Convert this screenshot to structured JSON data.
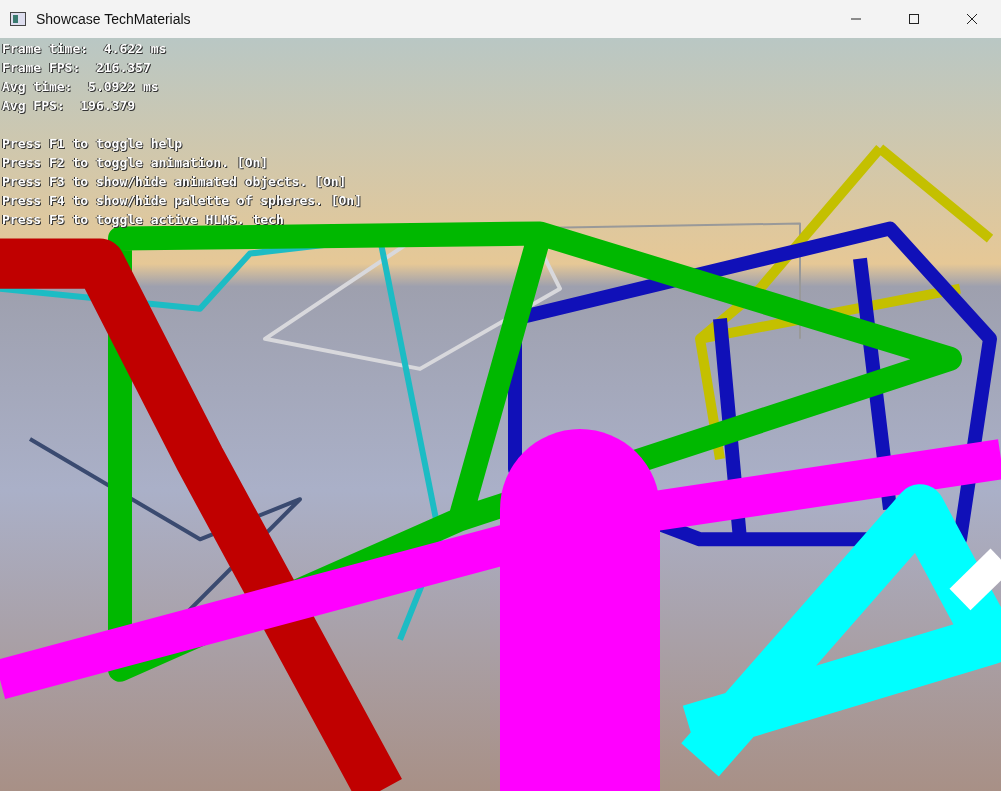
{
  "window": {
    "title": "Showcase TechMaterials"
  },
  "stats": [
    "Frame time:  4.622 ms",
    "Frame FPS:  216.357",
    "Avg time:  5.0922 ms",
    "Avg FPS:  196.379"
  ],
  "help": [
    "Press F1 to toggle help",
    "Press F2 to toggle animation. [On]",
    "Press F3 to show/hide animated objects. [On]",
    "Press F4 to show/hide palette of spheres. [On]",
    "Press F5 to toggle active HLMS. tech"
  ]
}
